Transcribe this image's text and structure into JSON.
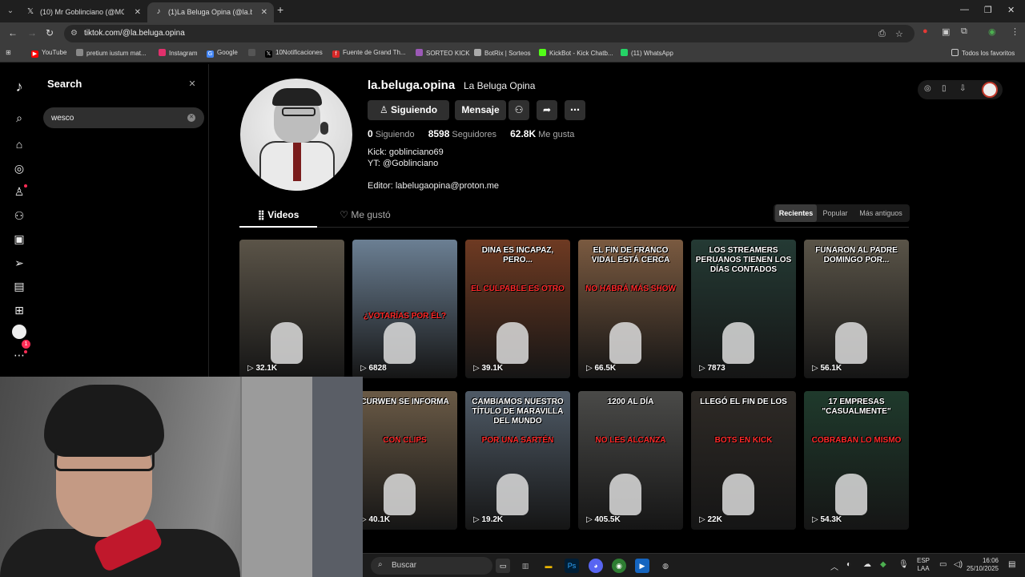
{
  "browser": {
    "tabs": [
      {
        "label": "(10) Mr Goblinciano (@MGobli",
        "icon": "x-logo-icon",
        "active": false
      },
      {
        "label": "(1)La Beluga Opina (@la.belug",
        "icon": "tiktok-logo-icon",
        "active": true
      }
    ],
    "url": "tiktok.com/@la.beluga.opina",
    "bookmarks": [
      {
        "label": "YouTube",
        "color": "#ff0000"
      },
      {
        "label": "pretium iustum mat...",
        "color": "#888888"
      },
      {
        "label": "Instagram",
        "color": "#e1306c"
      },
      {
        "label": "Google",
        "color": "#4285f4"
      },
      {
        "label": "",
        "color": "#555555"
      },
      {
        "label": "10Notificaciones",
        "color": "#000000"
      },
      {
        "label": "Fuente de Grand Th...",
        "color": "#d62828"
      },
      {
        "label": "SORTEO KICK",
        "color": "#9b59b6"
      },
      {
        "label": "BotRix | Sorteos",
        "color": "#aaaaaa"
      },
      {
        "label": "KickBot - Kick Chatb...",
        "color": "#53fc18"
      },
      {
        "label": "(11) WhatsApp",
        "color": "#25d366"
      }
    ],
    "all_bookmarks": "Todos los favoritos"
  },
  "search_panel": {
    "title": "Search",
    "query": "wesco"
  },
  "nav": {
    "badge_count": "1"
  },
  "profile": {
    "username": "la.beluga.opina",
    "nickname": "La Beluga Opina",
    "following_button": "Siguiendo",
    "message_button": "Mensaje",
    "stats": {
      "following_count": "0",
      "following_label": "Siguiendo",
      "followers_count": "8598",
      "followers_label": "Seguidores",
      "likes_count": "62.8K",
      "likes_label": "Me gusta"
    },
    "bio_lines": [
      "Kick: goblinciano69",
      "YT: @Goblinciano",
      "Editor: labelugaopina@proton.me"
    ]
  },
  "content_tabs": {
    "videos": "Videos",
    "liked": "Me gustó"
  },
  "sort": {
    "recent": "Recientes",
    "popular": "Popular",
    "oldest": "Más antiguos",
    "selected": "Recientes"
  },
  "videos": [
    {
      "caption_white": "",
      "caption_red": "",
      "views": "32.1K",
      "bg": "#5b5448"
    },
    {
      "caption_white": "",
      "caption_red": "¿VOTARÍAS POR ÉL?",
      "views": "6828",
      "bg": "#6b7f93"
    },
    {
      "caption_white": "DINA ES INCAPAZ, PERO...",
      "caption_red": "EL CULPABLE ES OTRO",
      "views": "39.1K",
      "bg": "#6e3a22"
    },
    {
      "caption_white": "EL FIN DE FRANCO VIDAL ESTÁ CERCA",
      "caption_red": "NO HABRÁ MÁS SHOW",
      "views": "66.5K",
      "bg": "#7a5a40"
    },
    {
      "caption_white": "LOS STREAMERS PERUANOS TIENEN LOS DÍAS CONTADOS",
      "caption_red": "",
      "views": "7873",
      "bg": "#243a34"
    },
    {
      "caption_white": "FUNARON AL PADRE DOMINGO POR...",
      "caption_red": "",
      "views": "56.1K",
      "bg": "#5a5448"
    },
    {
      "caption_white": "",
      "caption_red": "",
      "views": "",
      "bg": "#333333"
    },
    {
      "caption_white": "CURWEN SE INFORMA",
      "caption_red": "CON CLIPS",
      "views": "40.1K",
      "bg": "#6a5a46"
    },
    {
      "caption_white": "CAMBIAMOS NUESTRO TÍTULO DE MARAVILLA DEL MUNDO",
      "caption_red": "POR UNA SARTÉN",
      "views": "19.2K",
      "bg": "#4f5a66"
    },
    {
      "caption_white": "1200 AL DÍA",
      "caption_red": "NO LES ALCANZA",
      "views": "405.5K",
      "bg": "#4a4a48"
    },
    {
      "caption_white": "LLEGÓ EL FIN DE LOS",
      "caption_red": "BOTS EN KICK",
      "views": "22K",
      "bg": "#2e2a26"
    },
    {
      "caption_white": "17 EMPRESAS \"CASUALMENTE\"",
      "caption_red": "COBRABAN LO MISMO",
      "views": "54.3K",
      "bg": "#1f3a2c"
    }
  ],
  "taskbar": {
    "search_placeholder": "Buscar",
    "lang_line1": "ESP",
    "lang_line2": "LAA",
    "time": "16:06",
    "date": "25/10/2025"
  }
}
